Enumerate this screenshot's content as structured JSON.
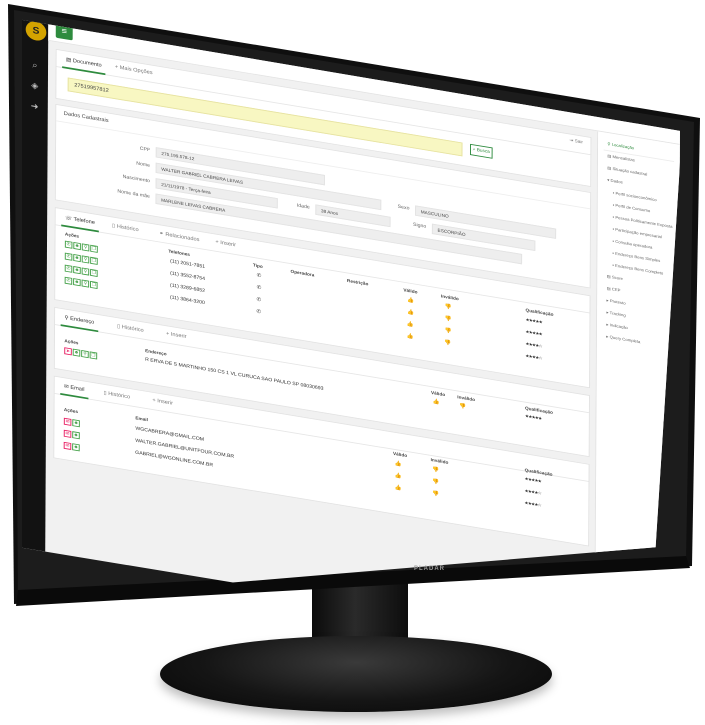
{
  "logo_text": "S",
  "left_icons": [
    "search-icon",
    "tag-icon",
    "logout-icon"
  ],
  "top_tabs": {
    "documento": "Documento",
    "mais_opcoes": "Mais Opções"
  },
  "document_number": "27519957812",
  "busca_label": "Busca",
  "sair_label": "Sair",
  "dados": {
    "title": "Dados Cadastrais",
    "cpf_label": "CPF",
    "cpf_value": "275.199.578-12",
    "nome_label": "Nome",
    "nome_value": "WALTER GABRIEL CABRERA LEIVAS",
    "sexo_label": "Sexo",
    "sexo_value": "MASCULINO",
    "nascimento_label": "Nascimento",
    "nascimento_value": "21/11/1978 - Terça-feira",
    "idade_label": "Idade",
    "idade_value": "38 Anos",
    "signo_label": "Signo",
    "signo_value": "ESCORPIÃO",
    "mae_label": "Nome da mãe",
    "mae_value": "MARLENE LEIVAS CABRERA"
  },
  "phone_tabs": {
    "telefone": "Telefone",
    "historico": "Histórico",
    "relacionados": "Relacionados",
    "inserir": "Inserir"
  },
  "phone_headers": {
    "acoes": "Ações",
    "telefones": "Telefones",
    "tipo": "Tipo",
    "operadora": "Operadora",
    "restricao": "Restrição",
    "valido": "Válido",
    "invalido": "Inválido",
    "qualificacao": "Qualificação"
  },
  "phones": [
    {
      "number": "(11) 2051-7851",
      "stars": "★★★★★"
    },
    {
      "number": "(11) 3552-8754",
      "stars": "★★★★★"
    },
    {
      "number": "(11) 3289-6852",
      "stars": "★★★★☆"
    },
    {
      "number": "(11) 3864-3200",
      "stars": "★★★★☆"
    }
  ],
  "address_tabs": {
    "endereco": "Endereço",
    "historico": "Histórico",
    "inserir": "Inserir"
  },
  "address_headers": {
    "acoes": "Ações",
    "endereco": "Endereço",
    "valido": "Válido",
    "invalido": "Inválido",
    "qualificacao": "Qualificação"
  },
  "address": {
    "text": "R ERVA DE S MARTINHO 150 CS 1 VL CURUCA SAO PAULO SP 08030693",
    "stars": "★★★★★"
  },
  "email_tabs": {
    "email": "Email",
    "historico": "Histórico",
    "inserir": "Inserir"
  },
  "email_headers": {
    "acoes": "Ações",
    "email": "Email",
    "valido": "Válido",
    "invalido": "Inválido",
    "qualificacao": "Qualificação"
  },
  "emails": [
    {
      "text": "WGCABRERA@GMAIL.COM",
      "stars": "★★★★★"
    },
    {
      "text": "WALTER.GABRIEL@UNITFOUR.COM.BR",
      "stars": "★★★★☆"
    },
    {
      "text": "GABRIEL@WGONLINE.COM.BR",
      "stars": "★★★★☆"
    }
  ],
  "right_nav": [
    {
      "label": "Localização",
      "active": true,
      "sub": false
    },
    {
      "label": "Mensalistas",
      "active": false,
      "sub": false
    },
    {
      "label": "Situação cadastral",
      "active": false,
      "sub": false
    },
    {
      "label": "Dados",
      "active": false,
      "sub": false
    },
    {
      "label": "Perfil socioeconômico",
      "active": false,
      "sub": true
    },
    {
      "label": "Perfil de Consumo",
      "active": false,
      "sub": true
    },
    {
      "label": "Pessoa Politicamente Exposta",
      "active": false,
      "sub": true
    },
    {
      "label": "Participação empresarial",
      "active": false,
      "sub": true
    },
    {
      "label": "Consulta operadora",
      "active": false,
      "sub": true
    },
    {
      "label": "Endereço Bens Simples",
      "active": false,
      "sub": true
    },
    {
      "label": "Endereço Bens Completo",
      "active": false,
      "sub": true
    },
    {
      "label": "Score",
      "active": false,
      "sub": false
    },
    {
      "label": "CEP",
      "active": false,
      "sub": false
    },
    {
      "label": "Protesto",
      "active": false,
      "sub": false
    },
    {
      "label": "Tracking",
      "active": false,
      "sub": false
    },
    {
      "label": "Indicação",
      "active": false,
      "sub": false
    },
    {
      "label": "Query Completa",
      "active": false,
      "sub": false
    }
  ],
  "monitor_brand": "PLADAR",
  "colors": {
    "accent": "#2e8b3e",
    "highlight_input": "#f8f7c2",
    "thumb": "#1e88e5",
    "sidebar": "#121212"
  }
}
